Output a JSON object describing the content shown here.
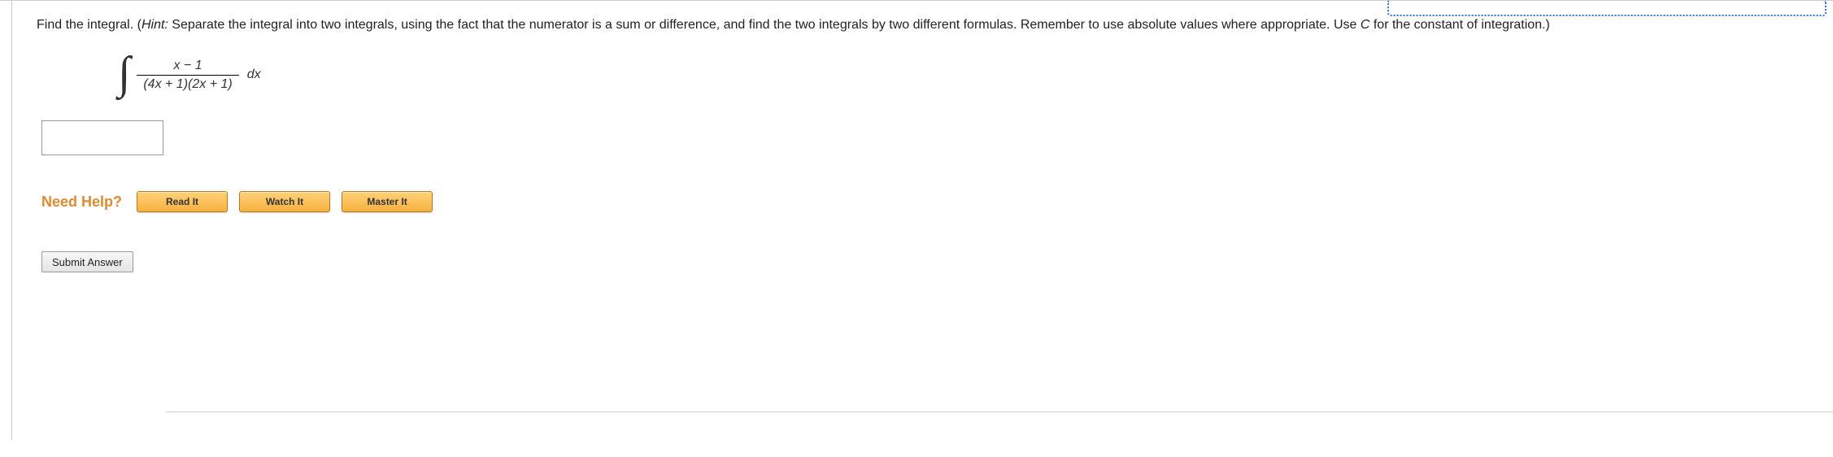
{
  "question": {
    "prompt_before_hint": "Find the integral. (",
    "hint_label": "Hint:",
    "hint_text": " Separate the integral into two integrals, using the fact that the numerator is a sum or difference, and find the two integrals by two different formulas. Remember to use absolute values where appropriate. Use ",
    "const_letter": "C",
    "prompt_after_const": " for the constant of integration.)",
    "integral": {
      "numerator": "x − 1",
      "denominator": "(4x + 1)(2x + 1)",
      "dx": "dx"
    }
  },
  "help": {
    "label": "Need Help?",
    "read": "Read It",
    "watch": "Watch It",
    "master": "Master It"
  },
  "submit": "Submit Answer"
}
